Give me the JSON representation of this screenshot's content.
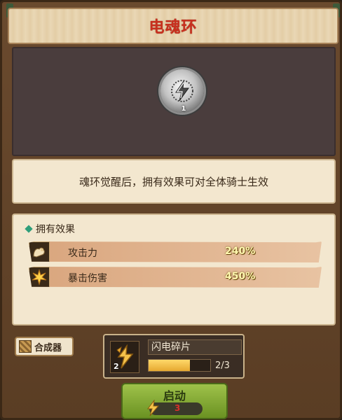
{
  "title": "电魂环",
  "badge": {
    "icon": "lightning-icon",
    "level": "1",
    "color": "#c0c0c0"
  },
  "description": "魂环觉醒后，拥有效果可对全体骑士生效",
  "effects": {
    "header": "拥有效果",
    "items": [
      {
        "icon": "muscle-arm-icon",
        "label": "攻击力",
        "value": "240%"
      },
      {
        "icon": "critical-burst-icon",
        "label": "暴击伤害",
        "value": "450%"
      }
    ]
  },
  "synth_button": {
    "label": "合成器",
    "icon": "crate-icon"
  },
  "material": {
    "icon": "lightning-shard-icon",
    "count": "2",
    "name": "闪电碎片",
    "progress_text": "2/3",
    "progress": 0.6667
  },
  "start_button": {
    "label": "启动",
    "cost_icon": "shard-icon",
    "cost": "3"
  },
  "colors": {
    "title": "#c8301e",
    "value": "#fff8b0",
    "accent_green": "#8ab23a",
    "cost": "#d8302a"
  }
}
